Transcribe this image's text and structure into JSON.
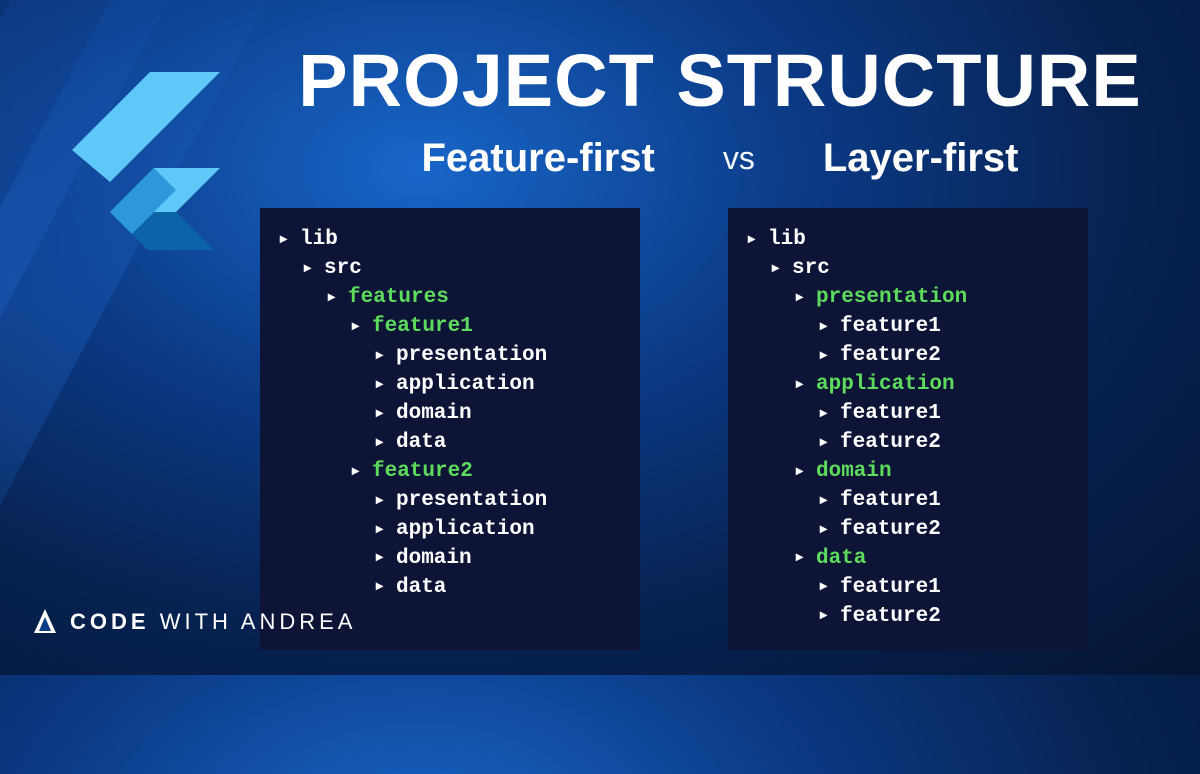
{
  "title": "PROJECT STRUCTURE",
  "subtitle": {
    "left": "Feature-first",
    "vs": "vs",
    "right": "Layer-first"
  },
  "tree_left": [
    {
      "indent": 0,
      "label": "lib",
      "color": "white"
    },
    {
      "indent": 1,
      "label": "src",
      "color": "white"
    },
    {
      "indent": 2,
      "label": "features",
      "color": "green"
    },
    {
      "indent": 3,
      "label": "feature1",
      "color": "green"
    },
    {
      "indent": 4,
      "label": "presentation",
      "color": "white"
    },
    {
      "indent": 4,
      "label": "application",
      "color": "white"
    },
    {
      "indent": 4,
      "label": "domain",
      "color": "white"
    },
    {
      "indent": 4,
      "label": "data",
      "color": "white"
    },
    {
      "indent": 3,
      "label": "feature2",
      "color": "green"
    },
    {
      "indent": 4,
      "label": "presentation",
      "color": "white"
    },
    {
      "indent": 4,
      "label": "application",
      "color": "white"
    },
    {
      "indent": 4,
      "label": "domain",
      "color": "white"
    },
    {
      "indent": 4,
      "label": "data",
      "color": "white"
    }
  ],
  "tree_right": [
    {
      "indent": 0,
      "label": "lib",
      "color": "white"
    },
    {
      "indent": 1,
      "label": "src",
      "color": "white"
    },
    {
      "indent": 2,
      "label": "presentation",
      "color": "green"
    },
    {
      "indent": 3,
      "label": "feature1",
      "color": "white"
    },
    {
      "indent": 3,
      "label": "feature2",
      "color": "white"
    },
    {
      "indent": 2,
      "label": "application",
      "color": "green"
    },
    {
      "indent": 3,
      "label": "feature1",
      "color": "white"
    },
    {
      "indent": 3,
      "label": "feature2",
      "color": "white"
    },
    {
      "indent": 2,
      "label": "domain",
      "color": "green"
    },
    {
      "indent": 3,
      "label": "feature1",
      "color": "white"
    },
    {
      "indent": 3,
      "label": "feature2",
      "color": "white"
    },
    {
      "indent": 2,
      "label": "data",
      "color": "green"
    },
    {
      "indent": 3,
      "label": "feature1",
      "color": "white"
    },
    {
      "indent": 3,
      "label": "feature2",
      "color": "white"
    }
  ],
  "footer": {
    "code": "CODE",
    "with": "WITH",
    "andrea": "ANDREA"
  }
}
